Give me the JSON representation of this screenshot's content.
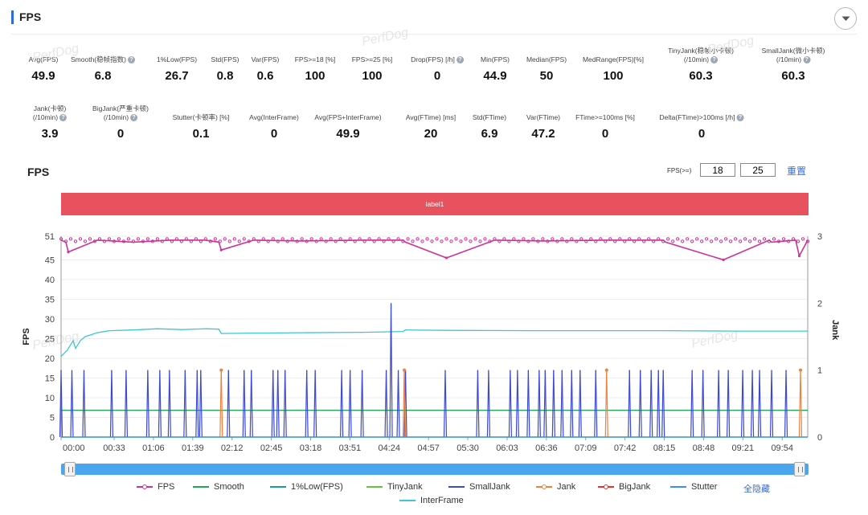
{
  "section": {
    "title": "FPS"
  },
  "watermark_text": "PerfDog",
  "metrics_row1": [
    {
      "label": "Avg(FPS)",
      "value": "49.9",
      "help": false
    },
    {
      "label": "Smooth(稳帧指数)",
      "value": "6.8",
      "help": true
    },
    {
      "label": "1%Low(FPS)",
      "value": "26.7",
      "help": false
    },
    {
      "label": "Std(FPS)",
      "value": "0.8",
      "help": false
    },
    {
      "label": "Var(FPS)",
      "value": "0.6",
      "help": false
    },
    {
      "label": "FPS>=18 [%]",
      "value": "100",
      "help": false
    },
    {
      "label": "FPS>=25 [%]",
      "value": "100",
      "help": false
    },
    {
      "label": "Drop(FPS) [/h]",
      "value": "0",
      "help": true
    },
    {
      "label": "Min(FPS)",
      "value": "44.9",
      "help": false
    },
    {
      "label": "Median(FPS)",
      "value": "50",
      "help": false
    },
    {
      "label": "MedRange(FPS)[%]",
      "value": "100",
      "help": false
    },
    {
      "label": "TinyJank(稳帧小卡顿)",
      "label2": "(/10min)",
      "value": "60.3",
      "help": true
    },
    {
      "label": "SmallJank(微小卡顿)",
      "label2": "(/10min)",
      "value": "60.3",
      "help": true
    }
  ],
  "metrics_row2": [
    {
      "label": "Jank(卡顿)",
      "label2": "(/10min)",
      "value": "3.9",
      "help": true
    },
    {
      "label": "BigJank(严重卡顿)",
      "label2": "(/10min)",
      "value": "0",
      "help": true
    },
    {
      "label": "Stutter(卡顿率) [%]",
      "value": "0.1",
      "help": false
    },
    {
      "label": "Avg(InterFrame)",
      "value": "0",
      "help": false
    },
    {
      "label": "Avg(FPS+InterFrame)",
      "value": "49.9",
      "help": false
    },
    {
      "label": "Avg(FTime) [ms]",
      "value": "20",
      "help": false
    },
    {
      "label": "Std(FTime)",
      "value": "6.9",
      "help": false
    },
    {
      "label": "Var(FTime)",
      "value": "47.2",
      "help": false
    },
    {
      "label": "FTime>=100ms [%]",
      "value": "0",
      "help": false
    },
    {
      "label": "Delta(FTime)>100ms [/h]",
      "value": "0",
      "help": true
    }
  ],
  "chart_header": {
    "title": "FPS",
    "threshold_label": "FPS(>=)",
    "threshold_1": "18",
    "threshold_2": "25",
    "reset_label": "重置"
  },
  "label_band": {
    "text": "label1",
    "color": "#e8525e"
  },
  "chart_data": {
    "type": "line",
    "title": "FPS",
    "xlabel": "",
    "ylabel": "FPS",
    "y2label": "Jank",
    "y_ticks": [
      "0",
      "5",
      "10",
      "15",
      "20",
      "25",
      "30",
      "35",
      "40",
      "45",
      "51"
    ],
    "y2_ticks": [
      "0",
      "1",
      "2",
      "3"
    ],
    "ylim": [
      0,
      51
    ],
    "y2lim": [
      0,
      3
    ],
    "x_ticks": [
      "00:00",
      "00:33",
      "01:06",
      "01:39",
      "02:12",
      "02:45",
      "03:18",
      "03:51",
      "04:24",
      "04:57",
      "05:30",
      "06:03",
      "06:36",
      "07:09",
      "07:42",
      "08:15",
      "08:48",
      "09:21",
      "09:54"
    ],
    "x_range_seconds": [
      0,
      620
    ],
    "grid": true,
    "legend_position": "bottom",
    "series": [
      {
        "name": "FPS",
        "axis": "left",
        "color": "#cc3399",
        "style": "line-marker",
        "x": [
          0,
          4,
          6,
          30,
          60,
          90,
          120,
          131,
          133,
          160,
          200,
          250,
          284,
          286,
          320,
          360,
          400,
          450,
          500,
          502,
          550,
          588,
          590,
          610,
          613,
          620
        ],
        "values": [
          50,
          49.5,
          47,
          50,
          49.5,
          50,
          50,
          49.5,
          47.5,
          50,
          49.8,
          50,
          50,
          49.5,
          45.5,
          50,
          49.8,
          50,
          50,
          49.5,
          45,
          50,
          49.5,
          50,
          46,
          50
        ]
      },
      {
        "name": "InterFrame",
        "axis": "left",
        "color": "#3cc7d6",
        "style": "line",
        "x": [
          0,
          5,
          10,
          12,
          14,
          16,
          20,
          30,
          40,
          60,
          80,
          100,
          120,
          131,
          133,
          160,
          200,
          250,
          284,
          286,
          320,
          400,
          500,
          560,
          620
        ],
        "values": [
          20.5,
          22,
          24.5,
          22.5,
          23.5,
          24.5,
          25.5,
          26.5,
          27,
          27.2,
          27.5,
          27.3,
          27.5,
          27.4,
          26.3,
          26.4,
          26.5,
          26.6,
          26.8,
          27.2,
          27.1,
          27,
          27,
          26.9,
          26.9
        ]
      },
      {
        "name": "Smooth",
        "axis": "left",
        "color": "#23a65a",
        "style": "line",
        "x": [
          0,
          620
        ],
        "values": [
          6.8,
          6.8
        ]
      },
      {
        "name": "1%Low(FPS)",
        "axis": "left",
        "color": "#1a9e96",
        "style": "line",
        "x": [
          0,
          620
        ],
        "values": [
          0,
          0
        ]
      },
      {
        "name": "TinyJank",
        "axis": "right",
        "color": "#62c43a",
        "style": "line",
        "x": [
          0,
          620
        ],
        "values": [
          0,
          0
        ]
      },
      {
        "name": "SmallJank",
        "axis": "right",
        "color": "#3a48d6",
        "style": "spikes",
        "x": [
          0,
          9,
          19,
          42,
          54,
          72,
          82,
          90,
          103,
          113,
          116,
          139,
          152,
          158,
          176,
          180,
          186,
          204,
          211,
          233,
          240,
          250,
          270,
          274,
          280,
          286,
          319,
          346,
          355,
          373,
          379,
          388,
          397,
          402,
          409,
          416,
          424,
          431,
          444,
          472,
          481,
          490,
          496,
          500,
          524,
          533,
          546,
          554,
          566,
          574,
          580,
          590,
          602
        ],
        "values": [
          1,
          1,
          1,
          1,
          1,
          1,
          1,
          1,
          1,
          1,
          1,
          1,
          1,
          1,
          1,
          1,
          1,
          1,
          1,
          1,
          1,
          1,
          1,
          2,
          1,
          1,
          1,
          1,
          1,
          1,
          1,
          1,
          1,
          1,
          1,
          1,
          1,
          1,
          1,
          1,
          1,
          1,
          1,
          1,
          1,
          1,
          1,
          1,
          1,
          1,
          1,
          1,
          1
        ]
      },
      {
        "name": "Jank",
        "axis": "right",
        "color": "#f0803c",
        "style": "spikes",
        "x": [
          133,
          285,
          453,
          614
        ],
        "values": [
          1,
          1,
          1,
          1
        ]
      },
      {
        "name": "BigJank",
        "axis": "right",
        "color": "#e8322f",
        "style": "spikes",
        "x": [],
        "values": []
      },
      {
        "name": "Stutter",
        "axis": "left",
        "color": "#3d8ef0",
        "style": "line",
        "x": [
          0,
          620
        ],
        "values": [
          0,
          0
        ]
      }
    ]
  },
  "legend": {
    "items": [
      {
        "name": "FPS",
        "color": "#cc3399",
        "marker": true
      },
      {
        "name": "Smooth",
        "color": "#23a65a",
        "marker": false
      },
      {
        "name": "1%Low(FPS)",
        "color": "#1a9e96",
        "marker": false
      },
      {
        "name": "TinyJank",
        "color": "#62c43a",
        "marker": false
      },
      {
        "name": "SmallJank",
        "color": "#3a48d6",
        "marker": false
      },
      {
        "name": "Jank",
        "color": "#f0803c",
        "marker": true
      },
      {
        "name": "BigJank",
        "color": "#e8322f",
        "marker": true
      },
      {
        "name": "Stutter",
        "color": "#3d8ef0",
        "marker": false
      },
      {
        "name": "InterFrame",
        "color": "#3cc7d6",
        "marker": false
      }
    ],
    "hide_all_label": "全隐藏"
  },
  "colors": {
    "accent": "#2f6bdc",
    "slider": "#4aa6ee"
  },
  "icons": {
    "collapse": "chevron-down-icon",
    "help": "question-circle-icon"
  }
}
